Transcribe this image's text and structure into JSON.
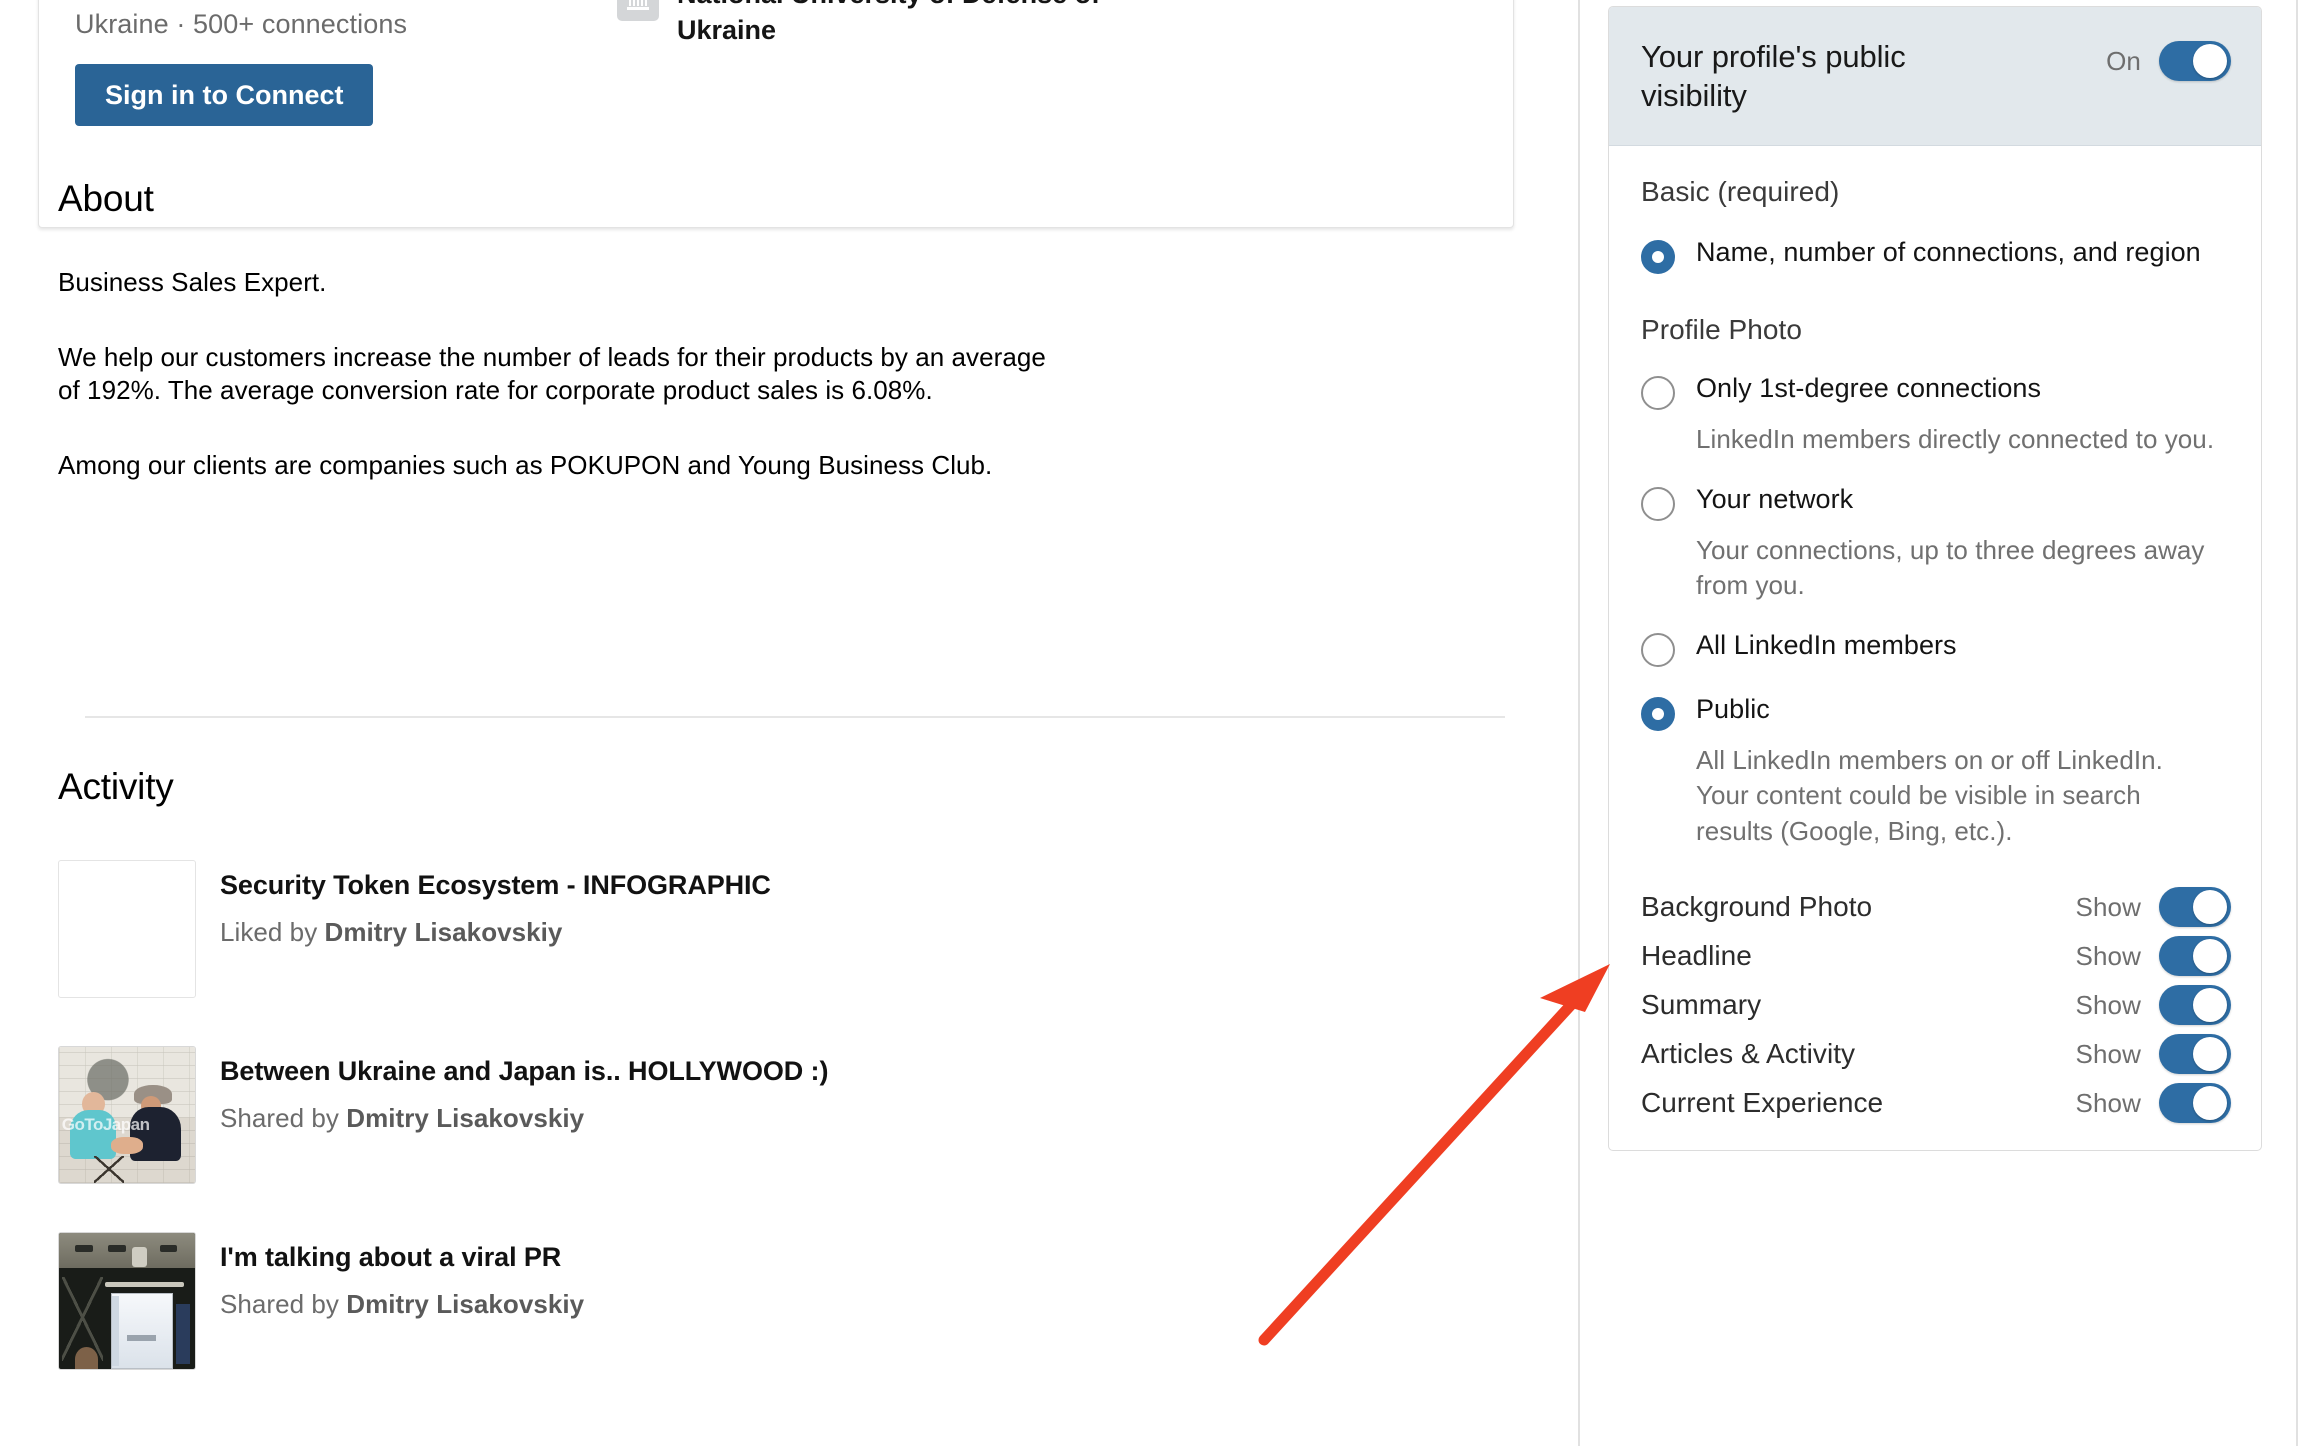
{
  "profile": {
    "meta": "Ukraine  ·  500+ connections",
    "signin_button": "Sign in to Connect",
    "school": "National University of Defense of Ukraine",
    "school_icon": "bank-icon"
  },
  "about": {
    "title": "About",
    "paragraph1": "Business Sales Expert.",
    "paragraph2": "We help our customers increase the number of leads for their products by an average of 192%. The average conversion rate for corporate product sales is 6.08%.",
    "paragraph3": "Among our clients are companies such as POKUPON and Young Business Club."
  },
  "activity": {
    "title": "Activity",
    "items": [
      {
        "title": "Security Token Ecosystem - INFOGRAPHIC",
        "action": "Liked by",
        "author": "Dmitry Lisakovskiy",
        "thumb": "empty"
      },
      {
        "title": "Between Ukraine and Japan is.. HOLLYWOOD :)",
        "action": "Shared by",
        "author": "Dmitry Lisakovskiy",
        "thumb": "handshake-photo"
      },
      {
        "title": "I'm talking about a viral PR",
        "action": "Shared by",
        "author": "Dmitry Lisakovskiy",
        "thumb": "conference-room-photo"
      }
    ]
  },
  "visibility_panel": {
    "header_title": "Your profile's public visibility",
    "header_state": "On",
    "header_toggle_on": true,
    "groups": [
      {
        "label": "Basic (required)"
      },
      {
        "label": "Profile Photo"
      }
    ],
    "basic_option": {
      "label": "Name, number of connections, and region",
      "checked": true
    },
    "photo_options": [
      {
        "label": "Only 1st-degree connections",
        "desc": "LinkedIn members directly connected to you.",
        "checked": false
      },
      {
        "label": "Your network",
        "desc": "Your connections, up to three degrees away from you.",
        "checked": false
      },
      {
        "label": "All LinkedIn members",
        "desc": "",
        "checked": false
      },
      {
        "label": "Public",
        "desc": "All LinkedIn members on or off LinkedIn. Your content could be visible in search results (Google, Bing, etc.).",
        "checked": true
      }
    ],
    "toggles": [
      {
        "label": "Background Photo",
        "state": "Show",
        "on": true
      },
      {
        "label": "Headline",
        "state": "Show",
        "on": true
      },
      {
        "label": "Summary",
        "state": "Show",
        "on": true
      },
      {
        "label": "Articles & Activity",
        "state": "Show",
        "on": true
      },
      {
        "label": "Current Experience",
        "state": "Show",
        "on": true
      }
    ]
  },
  "annotation": {
    "type": "arrow",
    "color": "#ef3e22",
    "points_at": "public-radio-option"
  },
  "colors": {
    "accent_blue": "#2e6da4",
    "button_blue": "#2a6496",
    "panel_header_bg": "#e2e8ec",
    "annotation_red": "#ef3e22",
    "text_primary": "#141414",
    "text_secondary": "#6e6e6e"
  }
}
